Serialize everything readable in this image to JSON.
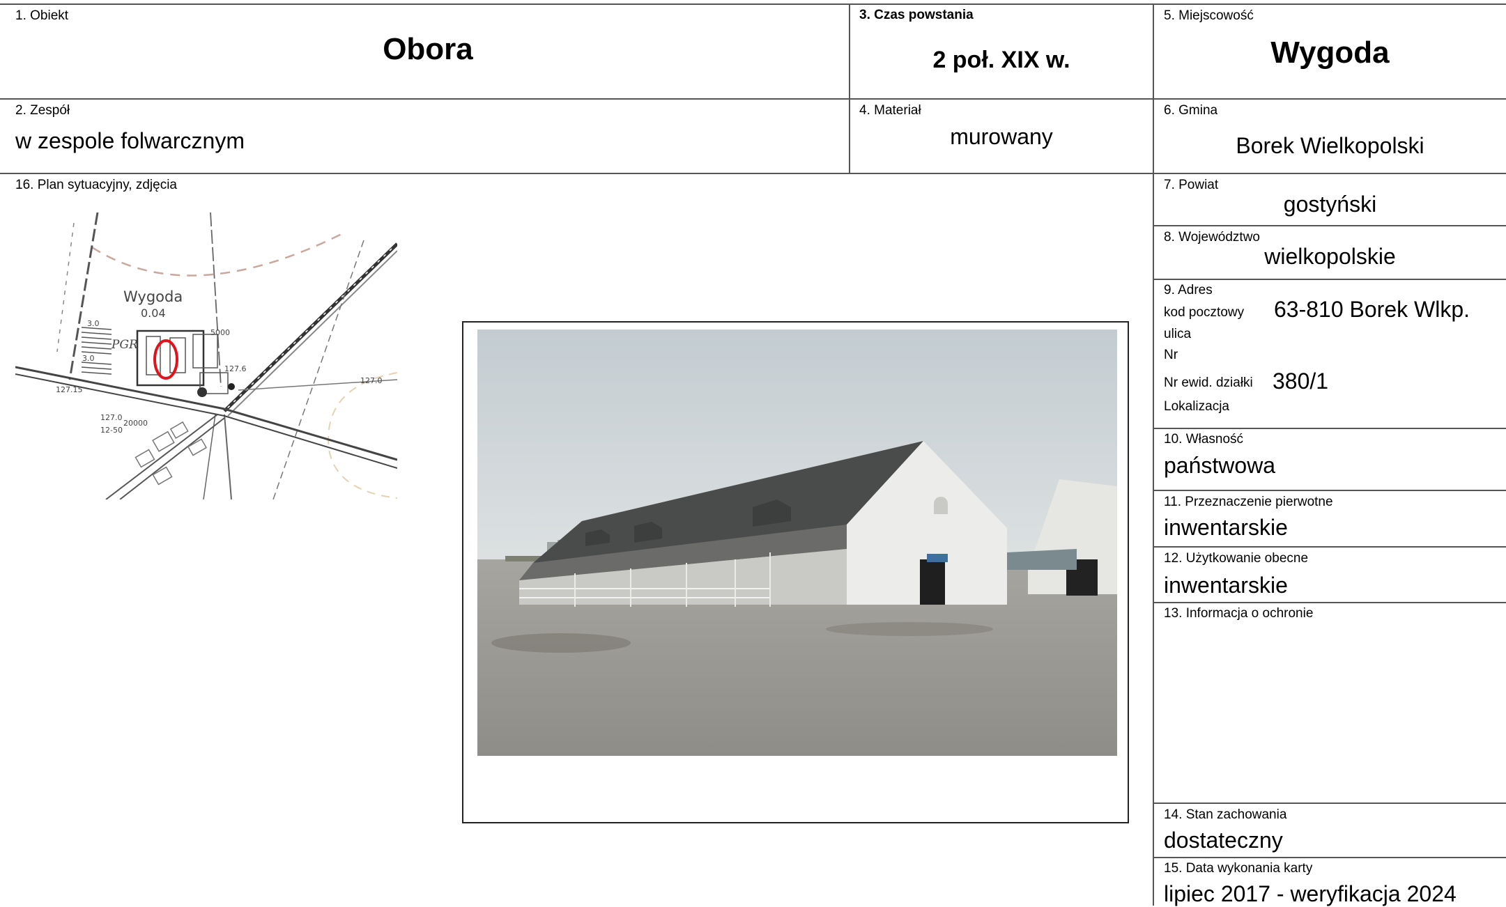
{
  "fields": {
    "obiekt": {
      "label": "1. Obiekt",
      "value": "Obora"
    },
    "zespol": {
      "label": "2. Zespół",
      "value": "w zespole folwarcznym"
    },
    "czas": {
      "label": "3. Czas powstania",
      "value": "2 poł. XIX w."
    },
    "material": {
      "label": "4. Materiał",
      "value": "murowany"
    },
    "miejscowosc": {
      "label": "5. Miejscowość",
      "value": "Wygoda"
    },
    "gmina": {
      "label": "6. Gmina",
      "value": "Borek Wielkopolski"
    },
    "powiat": {
      "label": "7. Powiat",
      "value": "gostyński"
    },
    "wojewodztwo": {
      "label": "8. Województwo",
      "value": "wielkopolskie"
    },
    "adres": {
      "label": "9. Adres",
      "kod_label": "kod pocztowy",
      "kod_value": "63-810 Borek Wlkp.",
      "ulica_label": "ulica",
      "nr_label": "Nr",
      "dzialka_label": "Nr ewid. działki",
      "dzialka_value": "380/1",
      "lokalizacja_label": "Lokalizacja"
    },
    "wlasnosc": {
      "label": "10. Własność",
      "value": "państwowa"
    },
    "przeznaczenie": {
      "label": "11. Przeznaczenie pierwotne",
      "value": "inwentarskie"
    },
    "uzytkowanie": {
      "label": "12. Użytkowanie obecne",
      "value": "inwentarskie"
    },
    "ochrona": {
      "label": "13. Informacja o ochronie",
      "value": ""
    },
    "stan": {
      "label": "14. Stan zachowania",
      "value": "dostateczny"
    },
    "data": {
      "label": "15. Data wykonania karty",
      "value": "lipiec 2017 - weryfikacja 2024"
    },
    "plan": {
      "label": "16. Plan sytuacyjny, zdjęcia"
    }
  },
  "map": {
    "place_name": "Wygoda",
    "place_number": "0.04",
    "pgr_label": "PGR",
    "labels": [
      "3.0",
      "3.0",
      "5000",
      "127.6",
      "127.0",
      "127.15",
      "127.0",
      "20000",
      "12-50"
    ],
    "marker_color": "#e0141b"
  }
}
